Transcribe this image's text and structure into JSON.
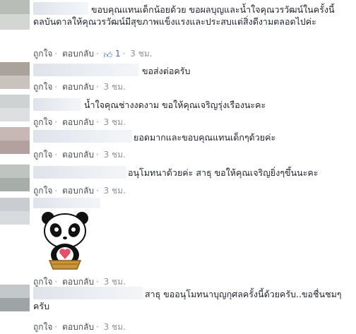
{
  "comments": [
    {
      "text": "ขอบคุณแทนเด็กน้อยด้วย ขอผลบุญและน้ำใจคุณวรวัฒน์ในครั้งนี้ดลบันดาลให้คุณวรวัฒน์มีสุขภาพแข็งแรงและประสบแต่สิ่งดีงามตลอดไปค่ะ",
      "like": "ถูกใจ",
      "reply": "ตอบกลับ",
      "likes": "1",
      "time": "3 ชม."
    },
    {
      "text": "ขอส่งต่อครับ",
      "like": "ถูกใจ",
      "reply": "ตอบกลับ",
      "time": "3 ชม."
    },
    {
      "text": "น้ำใจคุณช่างงดงาม ขอให้คุณเจริญรุ่งเรืองนะคะ",
      "like": "ถูกใจ",
      "reply": "ตอบกลับ",
      "time": "3 ชม."
    },
    {
      "text": "ยอดมากและขอบคุณแทนเด็กๆด้วยค่ะ",
      "like": "ถูกใจ",
      "reply": "ตอบกลับ",
      "time": "3 ชม."
    },
    {
      "text": "อนุโมทนาด้วยค่ะ สาธุ ขอให้คุณเจริญยิ่งๆขึ้นนะคะ",
      "like": "ถูกใจ",
      "reply": "ตอบกลับ",
      "time": "3 ชม."
    },
    {
      "sticker": "panda-heart-sticker",
      "like": "ถูกใจ",
      "reply": "ตอบกลับ",
      "time": "3 ชม."
    },
    {
      "text": "สาธุ ขออนุโมทนาบุญกุศลครั้งนี้ด้วยครับ..ขอชื่นชมๆครับ",
      "like": "ถูกใจ",
      "reply": "ตอบกลับ",
      "time": "3 ชม."
    }
  ],
  "colors": {
    "link": "#4267b2",
    "meta": "#90949c",
    "text": "#1d2129"
  }
}
